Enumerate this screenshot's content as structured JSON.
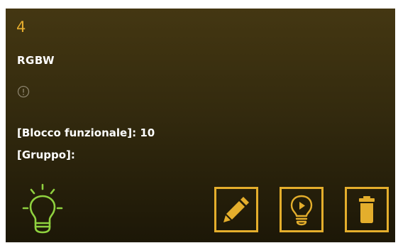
{
  "device": {
    "number": "4",
    "name": "RGBW",
    "block_label": "[Blocco funzionale]:",
    "block_value": "10",
    "group_label": "[Gruppo]:",
    "group_value": ""
  },
  "icons": {
    "info": "info-icon",
    "status": "lightbulb-on-icon",
    "edit": "pencil-icon",
    "scene": "lightbulb-play-icon",
    "delete": "trash-icon"
  },
  "colors": {
    "accent": "#e4ae2c",
    "status_on": "#8fd13f",
    "text": "#ffffff",
    "card_top": "#443712",
    "card_bottom": "#1c1707"
  }
}
